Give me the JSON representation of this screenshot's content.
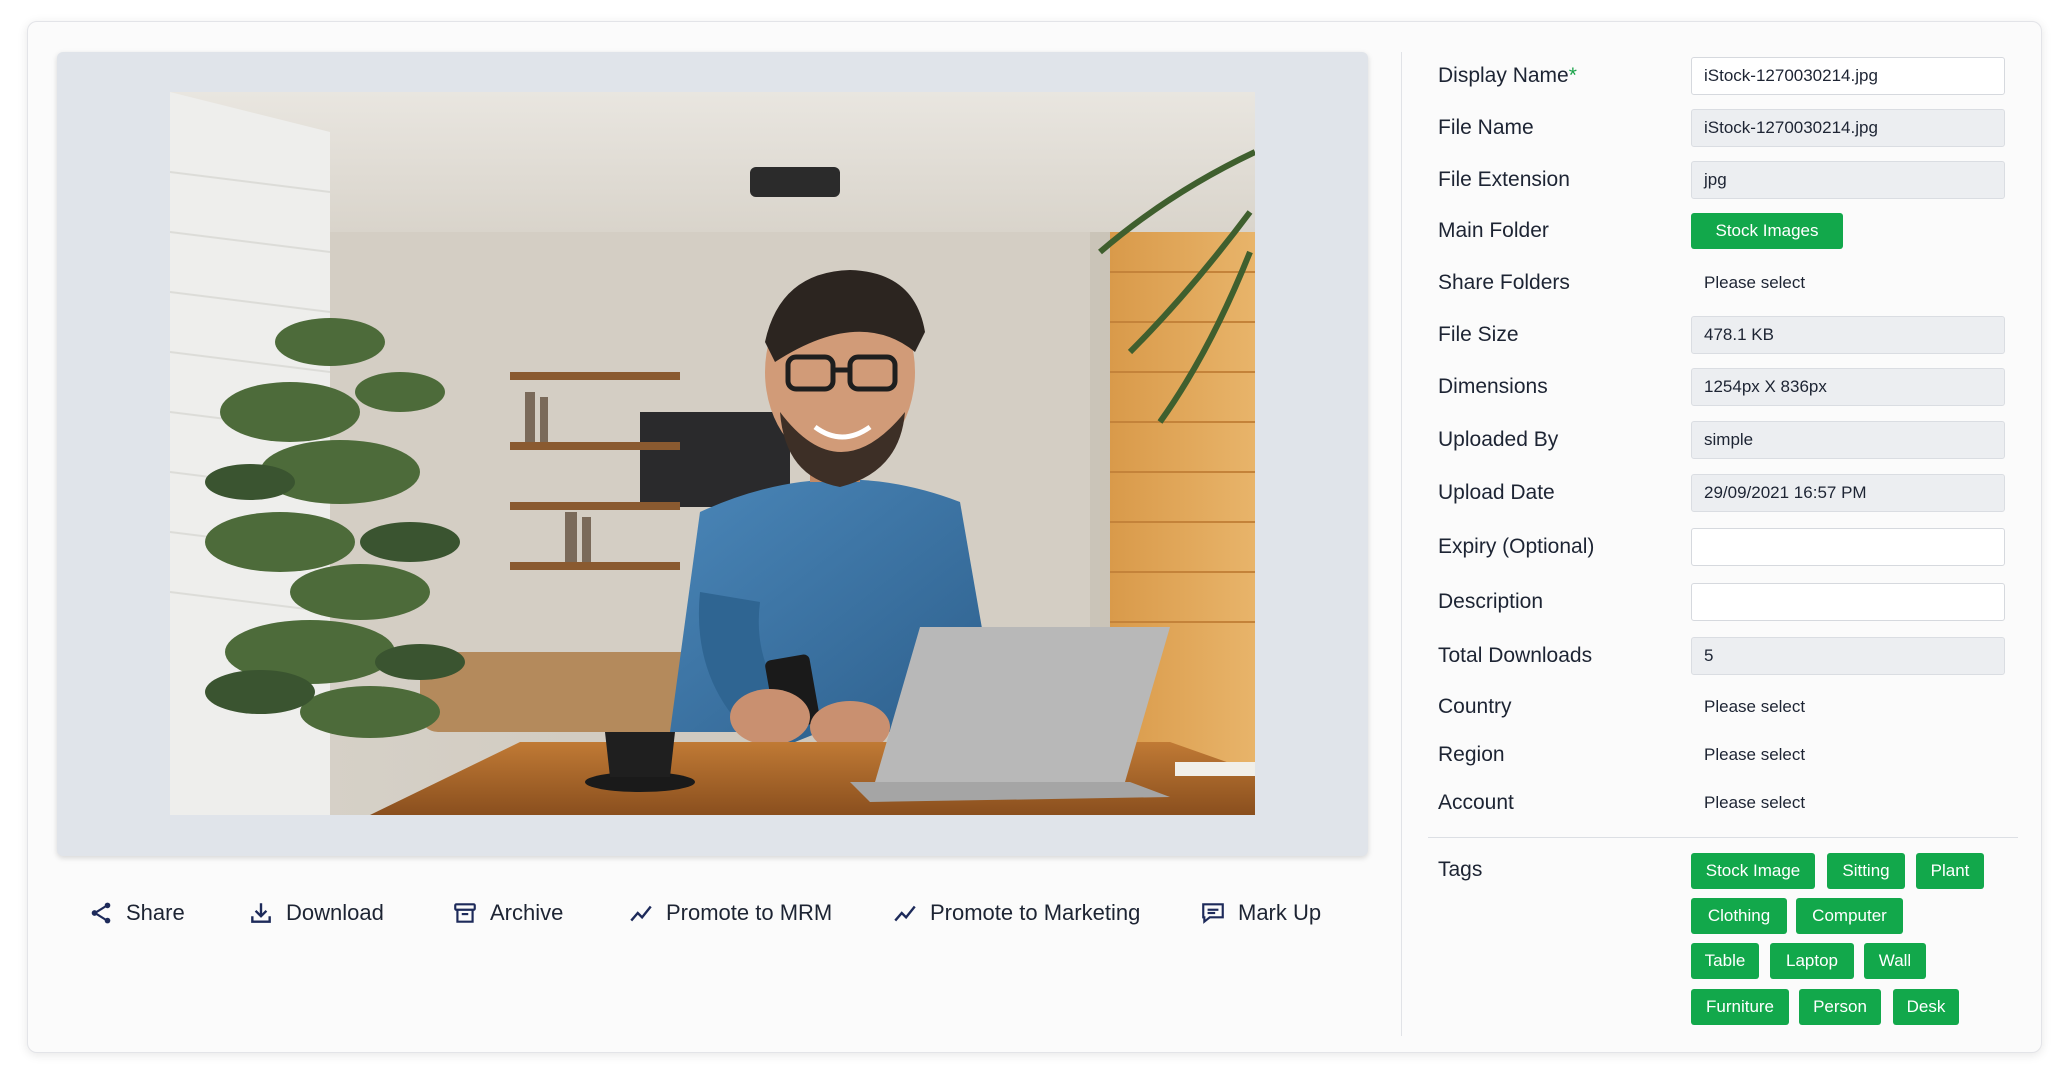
{
  "actions": {
    "share": "Share",
    "download": "Download",
    "archive": "Archive",
    "promote_mrm": "Promote to MRM",
    "promote_marketing": "Promote to Marketing",
    "mark_up": "Mark Up"
  },
  "fields": {
    "display_name": {
      "label": "Display Name",
      "required_mark": "*",
      "value": "iStock-1270030214.jpg"
    },
    "file_name": {
      "label": "File Name",
      "value": "iStock-1270030214.jpg"
    },
    "file_extension": {
      "label": "File Extension",
      "value": "jpg"
    },
    "main_folder": {
      "label": "Main Folder",
      "value": "Stock Images"
    },
    "share_folders": {
      "label": "Share Folders",
      "value": "Please select"
    },
    "file_size": {
      "label": "File Size",
      "value": "478.1 KB"
    },
    "dimensions": {
      "label": "Dimensions",
      "value": "1254px X 836px"
    },
    "uploaded_by": {
      "label": "Uploaded By",
      "value": "simple"
    },
    "upload_date": {
      "label": "Upload Date",
      "value": "29/09/2021 16:57 PM"
    },
    "expiry": {
      "label": "Expiry (Optional)",
      "value": ""
    },
    "description": {
      "label": "Description",
      "value": ""
    },
    "total_downloads": {
      "label": "Total Downloads",
      "value": "5"
    },
    "country": {
      "label": "Country",
      "value": "Please select"
    },
    "region": {
      "label": "Region",
      "value": "Please select"
    },
    "account": {
      "label": "Account",
      "value": "Please select"
    }
  },
  "tags": {
    "label": "Tags",
    "items": [
      "Stock Image",
      "Sitting",
      "Plant",
      "Clothing",
      "Computer",
      "Table",
      "Laptop",
      "Wall",
      "Furniture",
      "Person",
      "Desk"
    ]
  },
  "colors": {
    "accent_green": "#12a84b",
    "text": "#1d2433",
    "readonly_bg": "#eceef1",
    "preview_bg": "#e0e4ea"
  },
  "icons": {
    "share": "share-icon",
    "download": "download-icon",
    "archive": "archive-icon",
    "promote_mrm": "trend-icon",
    "promote_marketing": "trend-icon",
    "mark_up": "comment-icon"
  }
}
